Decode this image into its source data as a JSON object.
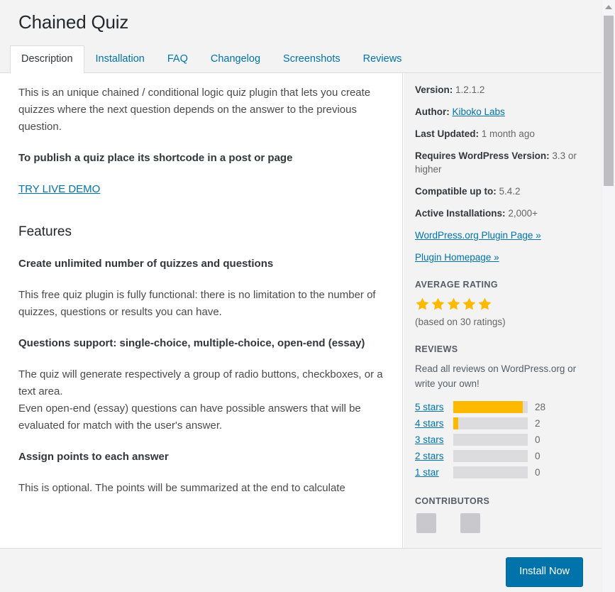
{
  "header": {
    "title": "Chained Quiz",
    "tabs": [
      {
        "label": "Description",
        "active": true
      },
      {
        "label": "Installation",
        "active": false
      },
      {
        "label": "FAQ",
        "active": false
      },
      {
        "label": "Changelog",
        "active": false
      },
      {
        "label": "Screenshots",
        "active": false
      },
      {
        "label": "Reviews",
        "active": false
      }
    ]
  },
  "content": {
    "intro": "This is an unique chained / conditional logic quiz plugin that lets you create quizzes where the next question depends on the answer to the previous question.",
    "shortcode_note": "To publish a quiz place its shortcode in a post or page",
    "demo_link": "TRY LIVE DEMO",
    "features_heading": "Features",
    "feature_1_title": "Create unlimited number of quizzes and questions",
    "feature_1_body": "This free quiz plugin is fully functional: there is no limitation to the number of quizzes, questions or results you can have.",
    "feature_2_title": "Questions support: single-choice, multiple-choice, open-end (essay)",
    "feature_2_body_line1": "The quiz will generate respectively a group of radio buttons, checkboxes, or a text area.",
    "feature_2_body_line2": "Even open-end (essay) questions can have possible answers that will be evaluated for match with the user's answer.",
    "feature_3_title": "Assign points to each answer",
    "feature_3_body": "This is optional. The points will be summarized at the end to calculate"
  },
  "sidebar": {
    "meta": [
      {
        "key": "Version:",
        "value": "1.2.1.2",
        "link": false
      },
      {
        "key": "Author:",
        "value": "Kiboko Labs",
        "link": true
      },
      {
        "key": "Last Updated:",
        "value": "1 month ago",
        "link": false
      },
      {
        "key": "Requires WordPress Version:",
        "value": "3.3 or higher",
        "link": false
      },
      {
        "key": "Compatible up to:",
        "value": "5.4.2",
        "link": false
      },
      {
        "key": "Active Installations:",
        "value": "2,000+",
        "link": false
      }
    ],
    "links": [
      {
        "label": "WordPress.org Plugin Page »"
      },
      {
        "label": "Plugin Homepage »"
      }
    ],
    "average_rating_heading": "AVERAGE RATING",
    "stars_filled": 5,
    "rating_count_text": "(based on 30 ratings)",
    "reviews_heading": "REVIEWS",
    "reviews_blurb": "Read all reviews on WordPress.org or write your own!",
    "rating_bars": [
      {
        "label": "5 stars",
        "count": "28",
        "percent": 93
      },
      {
        "label": "4 stars",
        "count": "2",
        "percent": 7
      },
      {
        "label": "3 stars",
        "count": "0",
        "percent": 0
      },
      {
        "label": "2 stars",
        "count": "0",
        "percent": 0
      },
      {
        "label": "1 star",
        "count": "0",
        "percent": 0
      }
    ],
    "contributors_heading": "CONTRIBUTORS",
    "contributors_count": 2
  },
  "footer": {
    "install_label": "Install Now"
  },
  "colors": {
    "link": "#0073aa",
    "star": "#ffb900",
    "button": "#0073aa",
    "sidebar_bg": "#f3f3f4"
  }
}
